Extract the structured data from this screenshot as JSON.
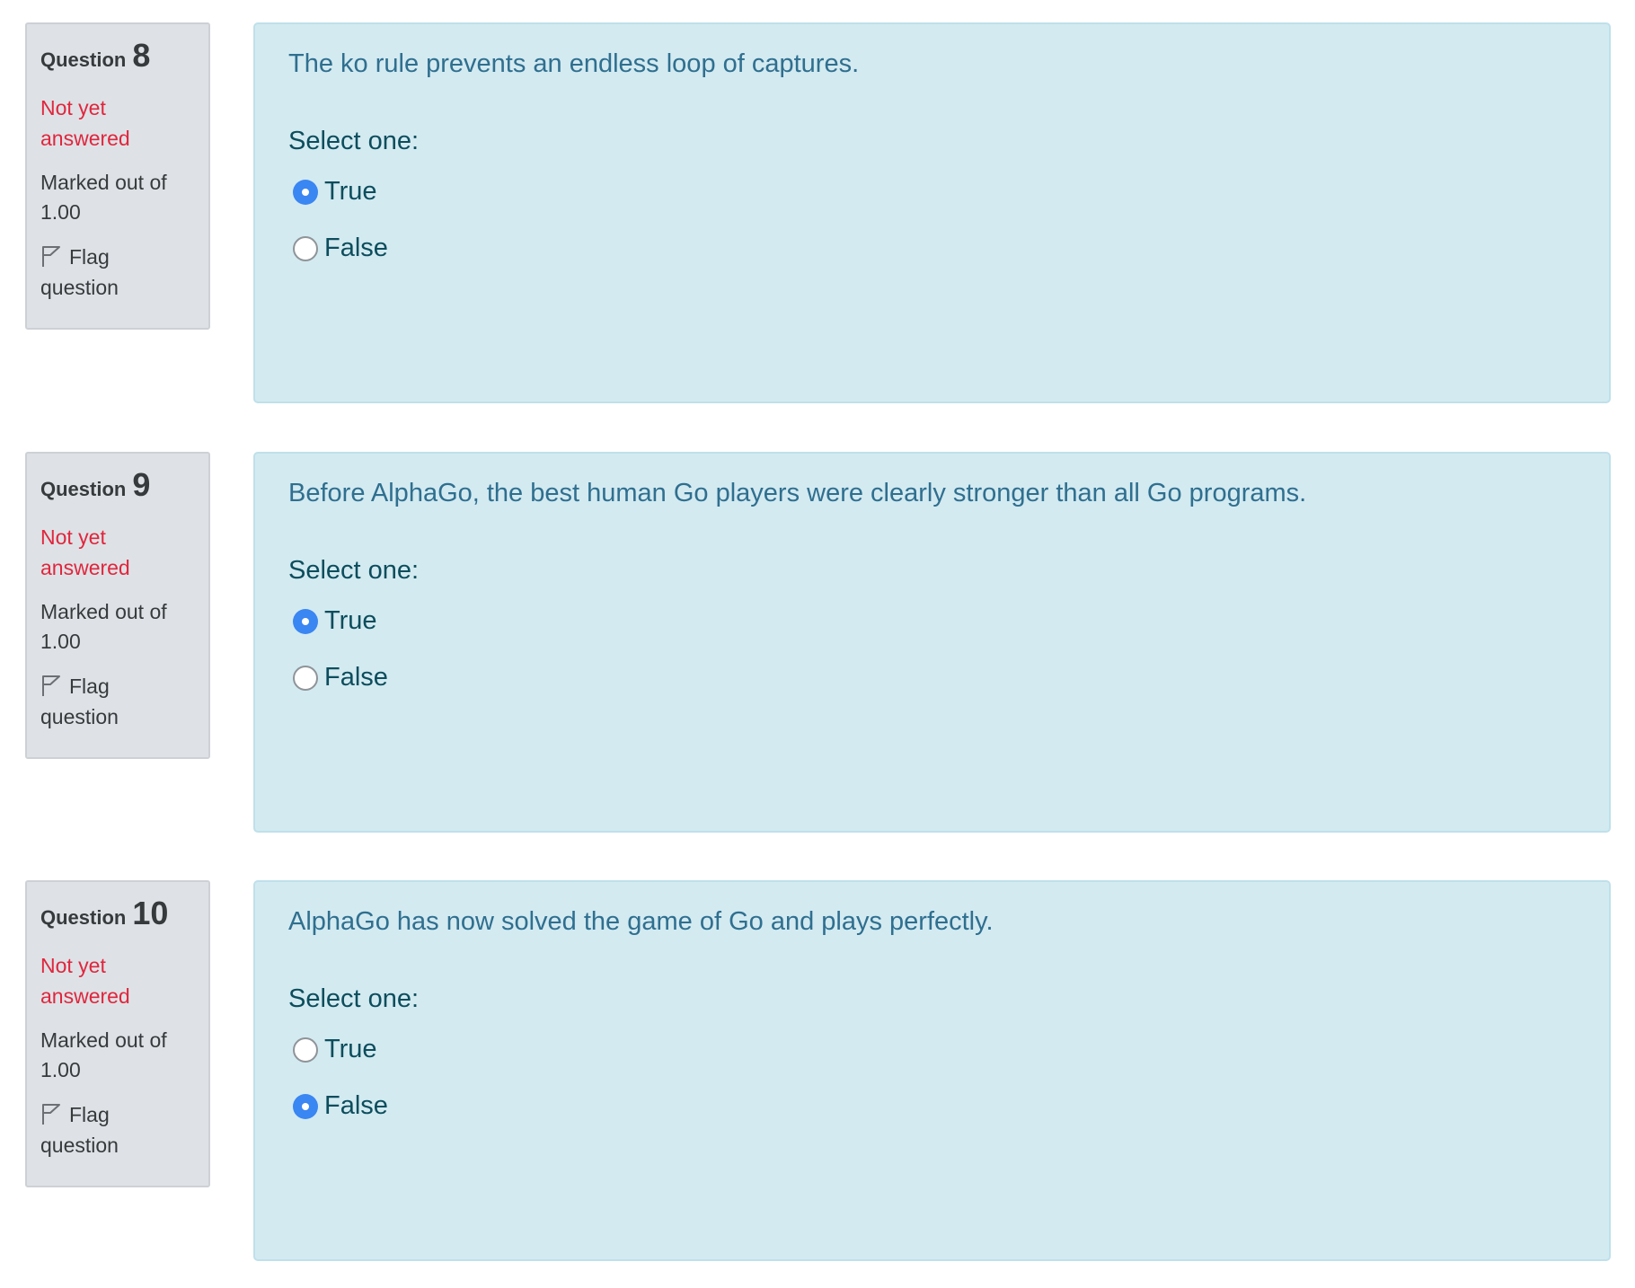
{
  "questions": [
    {
      "label": "Question",
      "number": "8",
      "state": "Not yet answered",
      "grade": "Marked out of 1.00",
      "flag_label": "Flag question",
      "text": "The ko rule prevents an endless loop of captures.",
      "prompt": "Select one:",
      "options": [
        {
          "label": "True",
          "selected": true
        },
        {
          "label": "False",
          "selected": false
        }
      ]
    },
    {
      "label": "Question",
      "number": "9",
      "state": "Not yet answered",
      "grade": "Marked out of 1.00",
      "flag_label": "Flag question",
      "text": "Before AlphaGo, the best human Go players were clearly stronger than all Go programs.",
      "prompt": "Select one:",
      "options": [
        {
          "label": "True",
          "selected": true
        },
        {
          "label": "False",
          "selected": false
        }
      ]
    },
    {
      "label": "Question",
      "number": "10",
      "state": "Not yet answered",
      "grade": "Marked out of 1.00",
      "flag_label": "Flag question",
      "text": "AlphaGo has now solved the game of Go and plays perfectly.",
      "prompt": "Select one:",
      "options": [
        {
          "label": "True",
          "selected": false
        },
        {
          "label": "False",
          "selected": true
        }
      ]
    }
  ],
  "icons": {
    "flag": "flag-icon",
    "radio_selected": "radio-selected-icon",
    "radio_unselected": "radio-unselected-icon"
  },
  "colors": {
    "info_background": "#dee2e6",
    "content_background": "#d3eaf1",
    "state_text": "#e0263d",
    "question_text": "#2f6f8f",
    "option_text": "#0c4d5c",
    "radio_selected": "#3a86f2"
  }
}
